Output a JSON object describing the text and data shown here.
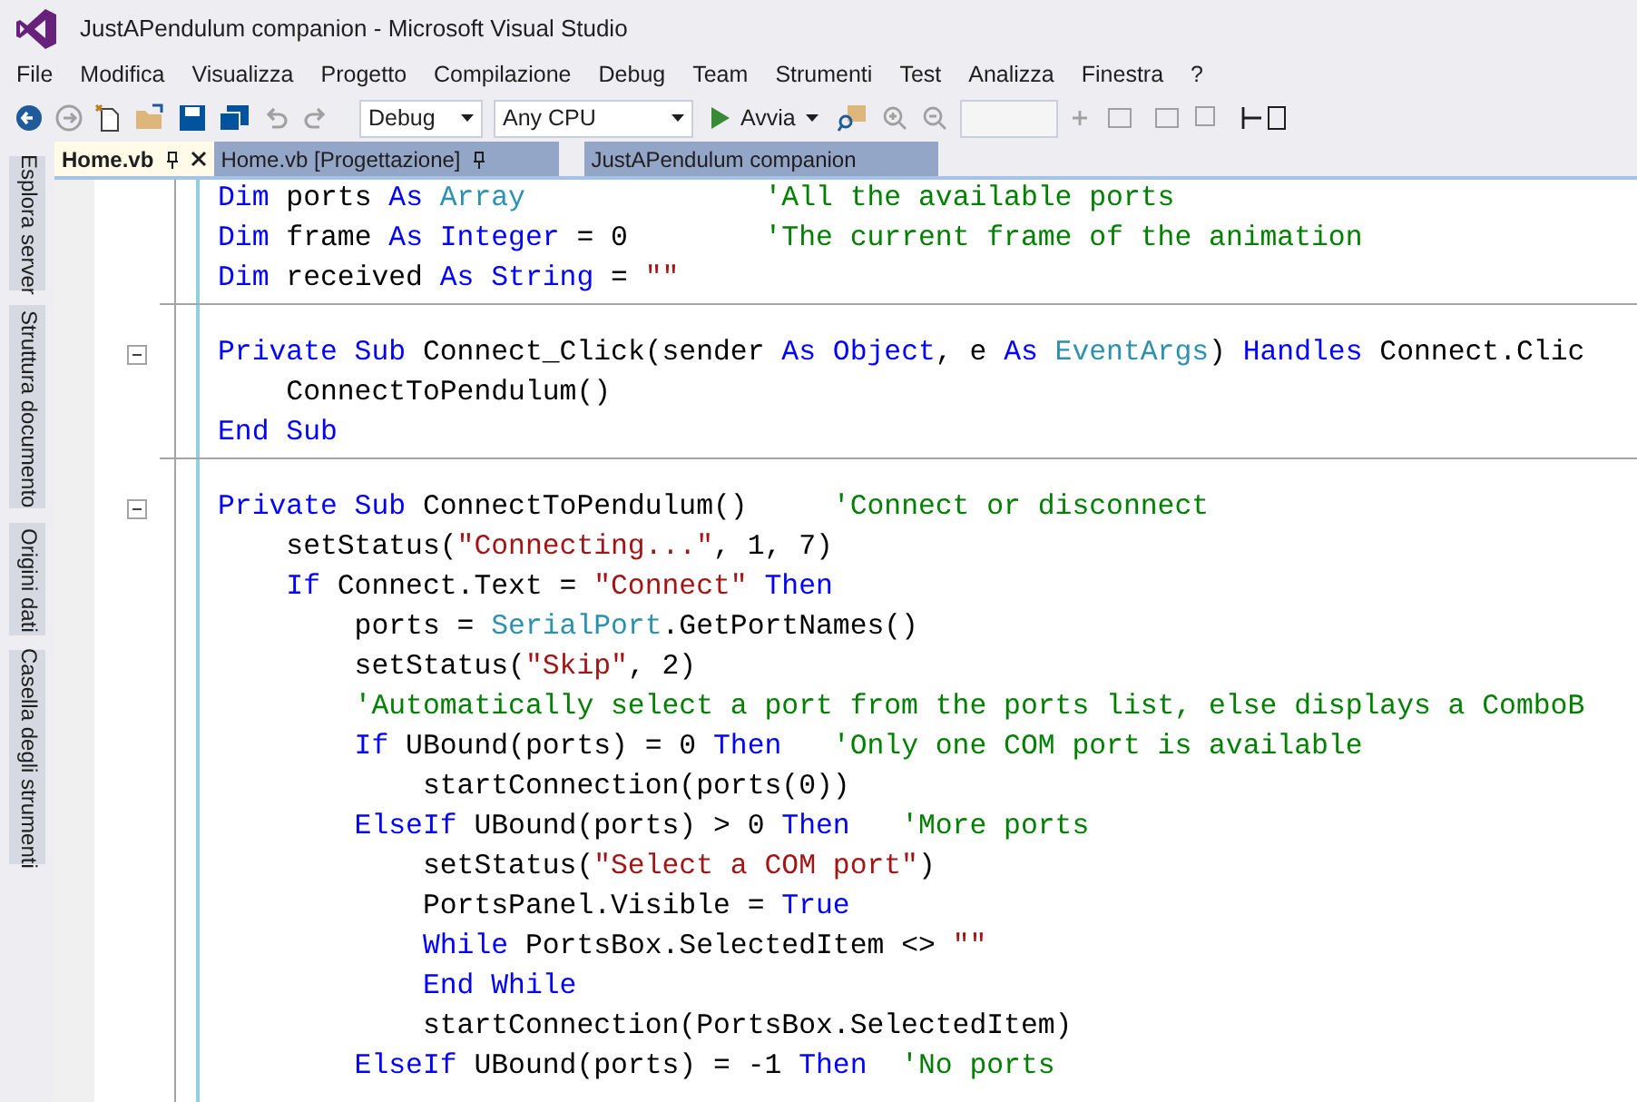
{
  "window": {
    "title": "JustAPendulum companion - Microsoft Visual Studio"
  },
  "menu": [
    "File",
    "Modifica",
    "Visualizza",
    "Progetto",
    "Compilazione",
    "Debug",
    "Team",
    "Strumenti",
    "Test",
    "Analizza",
    "Finestra",
    "?"
  ],
  "toolbar": {
    "configuration": "Debug",
    "platform": "Any CPU",
    "start_button": "Avvia"
  },
  "side_tabs": [
    "Esplora server",
    "Struttura documento",
    "Origini dati",
    "Casella degli strumenti"
  ],
  "document_tabs": [
    {
      "label": "Home.vb",
      "selected": true,
      "closable": true
    },
    {
      "label": "Home.vb [Progettazione]",
      "selected": false,
      "closable": false
    },
    {
      "label": "JustAPendulum companion",
      "selected": false,
      "closable": false
    }
  ],
  "code_lines": [
    {
      "kind": "code",
      "tokens": [
        {
          "kind": "kw",
          "s": "Dim"
        },
        {
          "kind": "plain",
          "s": " ports "
        },
        {
          "kind": "kw",
          "s": "As"
        },
        {
          "kind": "type",
          "s": " Array"
        },
        {
          "kind": "cmt",
          "s": "              'All the available ports"
        }
      ]
    },
    {
      "kind": "code",
      "tokens": [
        {
          "kind": "kw",
          "s": "Dim"
        },
        {
          "kind": "plain",
          "s": " frame "
        },
        {
          "kind": "kw",
          "s": "As"
        },
        {
          "kind": "kw",
          "s": " Integer"
        },
        {
          "kind": "plain",
          "s": " = 0"
        },
        {
          "kind": "cmt",
          "s": "        'The current frame of the animation"
        }
      ]
    },
    {
      "kind": "code",
      "tokens": [
        {
          "kind": "kw",
          "s": "Dim"
        },
        {
          "kind": "plain",
          "s": " received "
        },
        {
          "kind": "kw",
          "s": "As"
        },
        {
          "kind": "kw",
          "s": " String"
        },
        {
          "kind": "plain",
          "s": " = "
        },
        {
          "kind": "str",
          "s": "\"\""
        }
      ]
    },
    {
      "kind": "separator"
    },
    {
      "kind": "code",
      "expanded": true,
      "tokens": [
        {
          "kind": "kw",
          "s": "Private Sub"
        },
        {
          "kind": "plain",
          "s": " Connect_Click(sender "
        },
        {
          "kind": "kw",
          "s": "As Object"
        },
        {
          "kind": "plain",
          "s": ", e "
        },
        {
          "kind": "kw",
          "s": "As"
        },
        {
          "kind": "type",
          "s": " EventArgs"
        },
        {
          "kind": "plain",
          "s": ") "
        },
        {
          "kind": "kw",
          "s": "Handles"
        },
        {
          "kind": "plain",
          "s": " Connect.Clic"
        }
      ]
    },
    {
      "kind": "code",
      "tokens": [
        {
          "kind": "plain",
          "s": "    ConnectToPendulum()"
        }
      ]
    },
    {
      "kind": "code",
      "tokens": [
        {
          "kind": "kw",
          "s": "End Sub"
        }
      ]
    },
    {
      "kind": "separator"
    },
    {
      "kind": "code",
      "expanded": true,
      "tokens": [
        {
          "kind": "kw",
          "s": "Private Sub"
        },
        {
          "kind": "plain",
          "s": " ConnectToPendulum()"
        },
        {
          "kind": "cmt",
          "s": "     'Connect or disconnect"
        }
      ]
    },
    {
      "kind": "code",
      "tokens": [
        {
          "kind": "plain",
          "s": "    setStatus("
        },
        {
          "kind": "str",
          "s": "\"Connecting...\""
        },
        {
          "kind": "plain",
          "s": ", 1, 7)"
        }
      ]
    },
    {
      "kind": "code",
      "tokens": [
        {
          "kind": "kw",
          "s": "    If"
        },
        {
          "kind": "plain",
          "s": " Connect.Text = "
        },
        {
          "kind": "str",
          "s": "\"Connect\""
        },
        {
          "kind": "kw",
          "s": " Then"
        }
      ]
    },
    {
      "kind": "code",
      "tokens": [
        {
          "kind": "plain",
          "s": "        ports = "
        },
        {
          "kind": "type",
          "s": "SerialPort"
        },
        {
          "kind": "plain",
          "s": ".GetPortNames()"
        }
      ]
    },
    {
      "kind": "code",
      "tokens": [
        {
          "kind": "plain",
          "s": "        setStatus("
        },
        {
          "kind": "str",
          "s": "\"Skip\""
        },
        {
          "kind": "plain",
          "s": ", 2)"
        }
      ]
    },
    {
      "kind": "code",
      "tokens": [
        {
          "kind": "cmt",
          "s": "        'Automatically select a port from the ports list, else displays a ComboB"
        }
      ]
    },
    {
      "kind": "code",
      "tokens": [
        {
          "kind": "kw",
          "s": "        If"
        },
        {
          "kind": "plain",
          "s": " UBound(ports) = 0 "
        },
        {
          "kind": "kw",
          "s": "Then"
        },
        {
          "kind": "cmt",
          "s": "   'Only one COM port is available"
        }
      ]
    },
    {
      "kind": "code",
      "tokens": [
        {
          "kind": "plain",
          "s": "            startConnection(ports(0))"
        }
      ]
    },
    {
      "kind": "code",
      "tokens": [
        {
          "kind": "kw",
          "s": "        ElseIf"
        },
        {
          "kind": "plain",
          "s": " UBound(ports) > 0 "
        },
        {
          "kind": "kw",
          "s": "Then"
        },
        {
          "kind": "cmt",
          "s": "   'More ports"
        }
      ]
    },
    {
      "kind": "code",
      "tokens": [
        {
          "kind": "plain",
          "s": "            setStatus("
        },
        {
          "kind": "str",
          "s": "\"Select a COM port\""
        },
        {
          "kind": "plain",
          "s": ")"
        }
      ]
    },
    {
      "kind": "code",
      "tokens": [
        {
          "kind": "plain",
          "s": "            PortsPanel.Visible = "
        },
        {
          "kind": "kw",
          "s": "True"
        }
      ]
    },
    {
      "kind": "code",
      "tokens": [
        {
          "kind": "kw",
          "s": "            While"
        },
        {
          "kind": "plain",
          "s": " PortsBox.SelectedItem <> "
        },
        {
          "kind": "str",
          "s": "\"\""
        }
      ]
    },
    {
      "kind": "code",
      "tokens": [
        {
          "kind": "kw",
          "s": "            End While"
        }
      ]
    },
    {
      "kind": "code",
      "tokens": [
        {
          "kind": "plain",
          "s": "            startConnection(PortsBox.SelectedItem)"
        }
      ]
    },
    {
      "kind": "code",
      "tokens": [
        {
          "kind": "kw",
          "s": "        ElseIf"
        },
        {
          "kind": "plain",
          "s": " UBound(ports) = -1 "
        },
        {
          "kind": "kw",
          "s": "Then"
        },
        {
          "kind": "cmt",
          "s": "  'No ports"
        }
      ]
    }
  ]
}
